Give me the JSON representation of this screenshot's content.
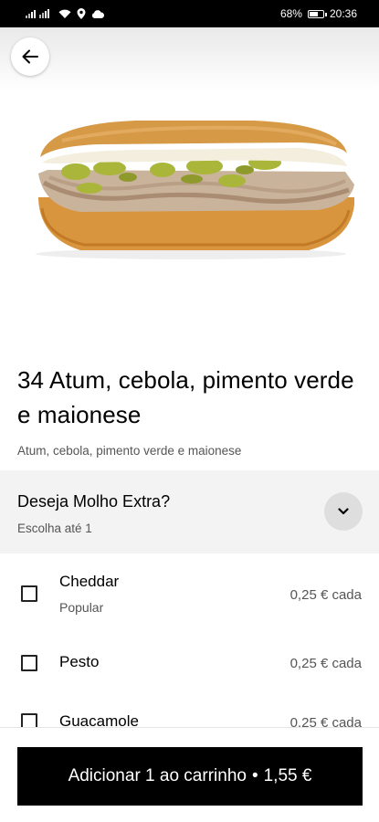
{
  "status": {
    "battery": "68%",
    "time": "20:36",
    "battery_level": 0.68
  },
  "icons": {
    "back": "arrow-left-icon",
    "expand": "chevron-down-icon",
    "signal": "signal-icon",
    "wifi": "wifi-icon",
    "location": "location-icon",
    "cloud": "cloud-icon",
    "battery": "battery-icon"
  },
  "product": {
    "title": "34 Atum, cebola, pimento verde e maionese",
    "description": "Atum, cebola, pimento verde e maionese"
  },
  "extras_section": {
    "title": "Deseja Molho Extra?",
    "subtitle": "Escolha até 1",
    "options": [
      {
        "name": "Cheddar",
        "tag": "Popular",
        "price": "0,25 € cada",
        "checked": false
      },
      {
        "name": "Pesto",
        "tag": "",
        "price": "0,25 € cada",
        "checked": false
      },
      {
        "name": "Guacamole",
        "tag": "",
        "price": "0,25 € cada",
        "checked": false
      }
    ]
  },
  "cta": {
    "label": "Adicionar 1 ao carrinho",
    "separator": "•",
    "price": "1,55 €"
  }
}
